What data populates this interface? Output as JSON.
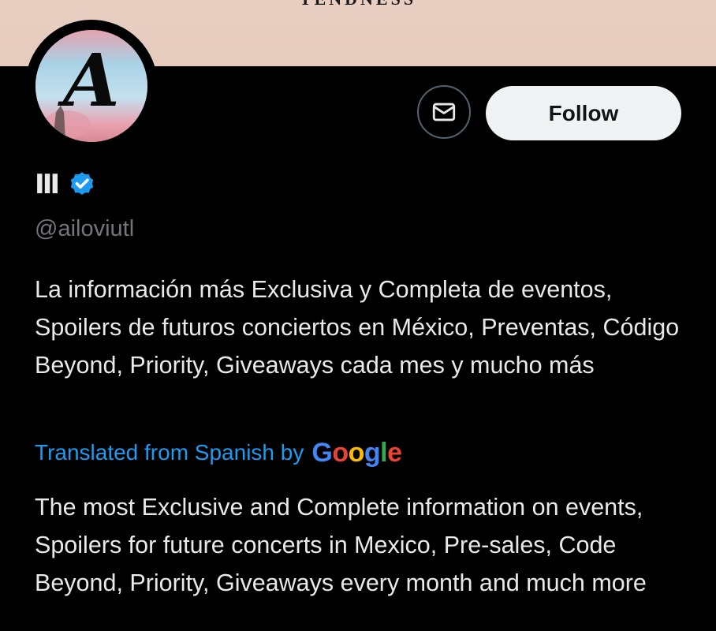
{
  "banner": {
    "partial_text": "TENDNESS"
  },
  "profile": {
    "avatar_letter": "A",
    "display_name": "Ⅲ",
    "verified_icon": "verified-badge-icon",
    "handle": "@ailoviutl",
    "bio": "La información más Exclusiva y Completa de eventos, Spoilers de futuros conciertos en México, Preventas, Código Beyond, Priority, Giveaways cada mes y mucho más",
    "translated_label": "Translated from Spanish by",
    "translated_provider": "Google",
    "translation": "The most Exclusive and Complete information on events, Spoilers for future concerts in Mexico, Pre-sales, Code Beyond, Priority, Giveaways every month and much more"
  },
  "actions": {
    "message_icon": "mail-icon",
    "follow_label": "Follow"
  },
  "colors": {
    "background": "#000000",
    "banner": "#e8cfc2",
    "primary_text": "#e7e9ea",
    "secondary_text": "#71767b",
    "link": "#1d9bf0",
    "verified": "#1d9bf0",
    "follow_button_bg": "#eff3f4"
  }
}
